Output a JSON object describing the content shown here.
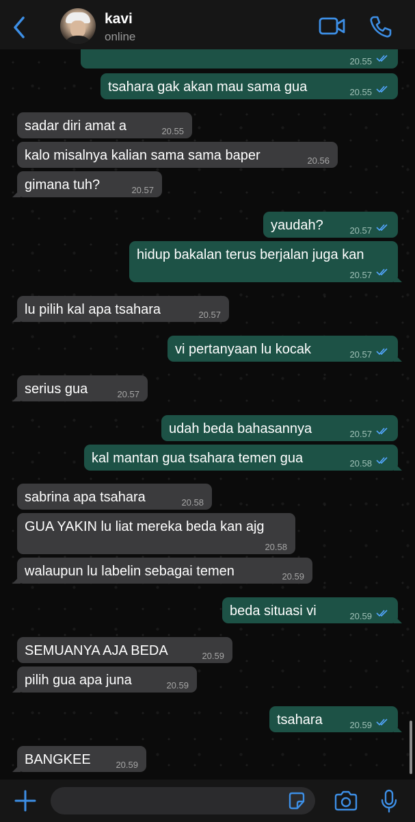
{
  "header": {
    "contact_name": "kavi",
    "contact_status": "online"
  },
  "colors": {
    "accent": "#3d8fe6",
    "incoming_bubble": "#3b3b3d",
    "outgoing_bubble": "#1d5246",
    "read_tick": "#53a6ff"
  },
  "messages": [
    {
      "dir": "out",
      "text": "",
      "time": "20.55",
      "read": true
    },
    {
      "dir": "out",
      "text": "tsahara gak akan mau sama gua",
      "time": "20.55",
      "read": true
    },
    {
      "dir": "in",
      "text": "sadar diri amat a",
      "time": "20.55"
    },
    {
      "dir": "in",
      "text": "kalo misalnya kalian sama sama baper",
      "time": "20.56"
    },
    {
      "dir": "in",
      "text": "gimana tuh?",
      "time": "20.57"
    },
    {
      "dir": "out",
      "text": "yaudah?",
      "time": "20.57",
      "read": true
    },
    {
      "dir": "out",
      "text": "hidup bakalan terus berjalan juga kan",
      "time": "20.57",
      "read": true
    },
    {
      "dir": "in",
      "text": "lu pilih kal apa tsahara",
      "time": "20.57"
    },
    {
      "dir": "out",
      "text": "vi pertanyaan lu kocak",
      "time": "20.57",
      "read": true
    },
    {
      "dir": "in",
      "text": "serius gua",
      "time": "20.57"
    },
    {
      "dir": "out",
      "text": "udah beda bahasannya",
      "time": "20.57",
      "read": true
    },
    {
      "dir": "out",
      "text": "kal mantan gua tsahara temen gua",
      "time": "20.58",
      "read": true
    },
    {
      "dir": "in",
      "text": "sabrina apa tsahara",
      "time": "20.58"
    },
    {
      "dir": "in",
      "text": "GUA YAKIN lu liat mereka beda kan ajg",
      "time": "20.58"
    },
    {
      "dir": "in",
      "text": "walaupun lu labelin sebagai temen",
      "time": "20.59"
    },
    {
      "dir": "out",
      "text": "beda situasi vi",
      "time": "20.59",
      "read": true
    },
    {
      "dir": "in",
      "text": "SEMUANYA AJA BEDA",
      "time": "20.59"
    },
    {
      "dir": "in",
      "text": "pilih gua apa juna",
      "time": "20.59"
    },
    {
      "dir": "out",
      "text": "tsahara",
      "time": "20.59",
      "read": true
    },
    {
      "dir": "in",
      "text": "BANGKEE",
      "time": "20.59"
    }
  ],
  "composer": {
    "value": ""
  }
}
